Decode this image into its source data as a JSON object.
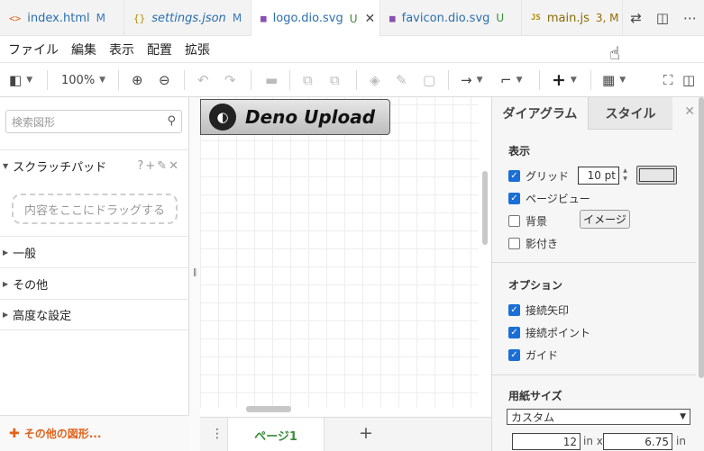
{
  "tabs": [
    {
      "icon": "<>",
      "name": "index.html",
      "mod": "M",
      "italic": false
    },
    {
      "icon": "{}",
      "name": "settings.json",
      "mod": "M",
      "italic": true
    },
    {
      "icon": "■",
      "name": "logo.dio.svg",
      "mod": "U",
      "italic": false,
      "close": "✕"
    },
    {
      "icon": "■",
      "name": "favicon.dio.svg",
      "mod": "U",
      "italic": false
    },
    {
      "icon": "JS",
      "name": "main.js",
      "mod": "3, M",
      "italic": false
    }
  ],
  "menu": [
    "ファイル",
    "編集",
    "表示",
    "配置",
    "拡張"
  ],
  "toolbar": {
    "zoom": "100%"
  },
  "sidebar": {
    "search_placeholder": "検索図形",
    "scratchpad": "スクラッチパッド",
    "scratchpad_actions": "?+✎✕",
    "dropzone": "内容をここにドラッグする",
    "sections": [
      "一般",
      "その他",
      "高度な設定"
    ],
    "more_shapes": "その他の図形..."
  },
  "canvas": {
    "shape_title": "Deno Upload"
  },
  "pages": {
    "current": "ページ1"
  },
  "panel": {
    "tab_diagram": "ダイアグラム",
    "tab_style": "スタイル",
    "view_label": "表示",
    "grid": "グリッド",
    "grid_size": "10 pt",
    "page_view": "ページビュー",
    "background": "背景",
    "image_button": "イメージ",
    "shadow": "影付き",
    "options_label": "オプション",
    "connection_arrows": "接続矢印",
    "connection_points": "接続ポイント",
    "guides": "ガイド",
    "paper_size_label": "用紙サイズ",
    "paper_size": "カスタム",
    "width": "12",
    "height": "6.75",
    "unit_x": "in x",
    "unit": "in"
  },
  "colors": {
    "accent": "#1a6fd6",
    "modified": "#3a78b8",
    "untracked": "#3a8e3a",
    "more_shapes": "#e0621a"
  }
}
